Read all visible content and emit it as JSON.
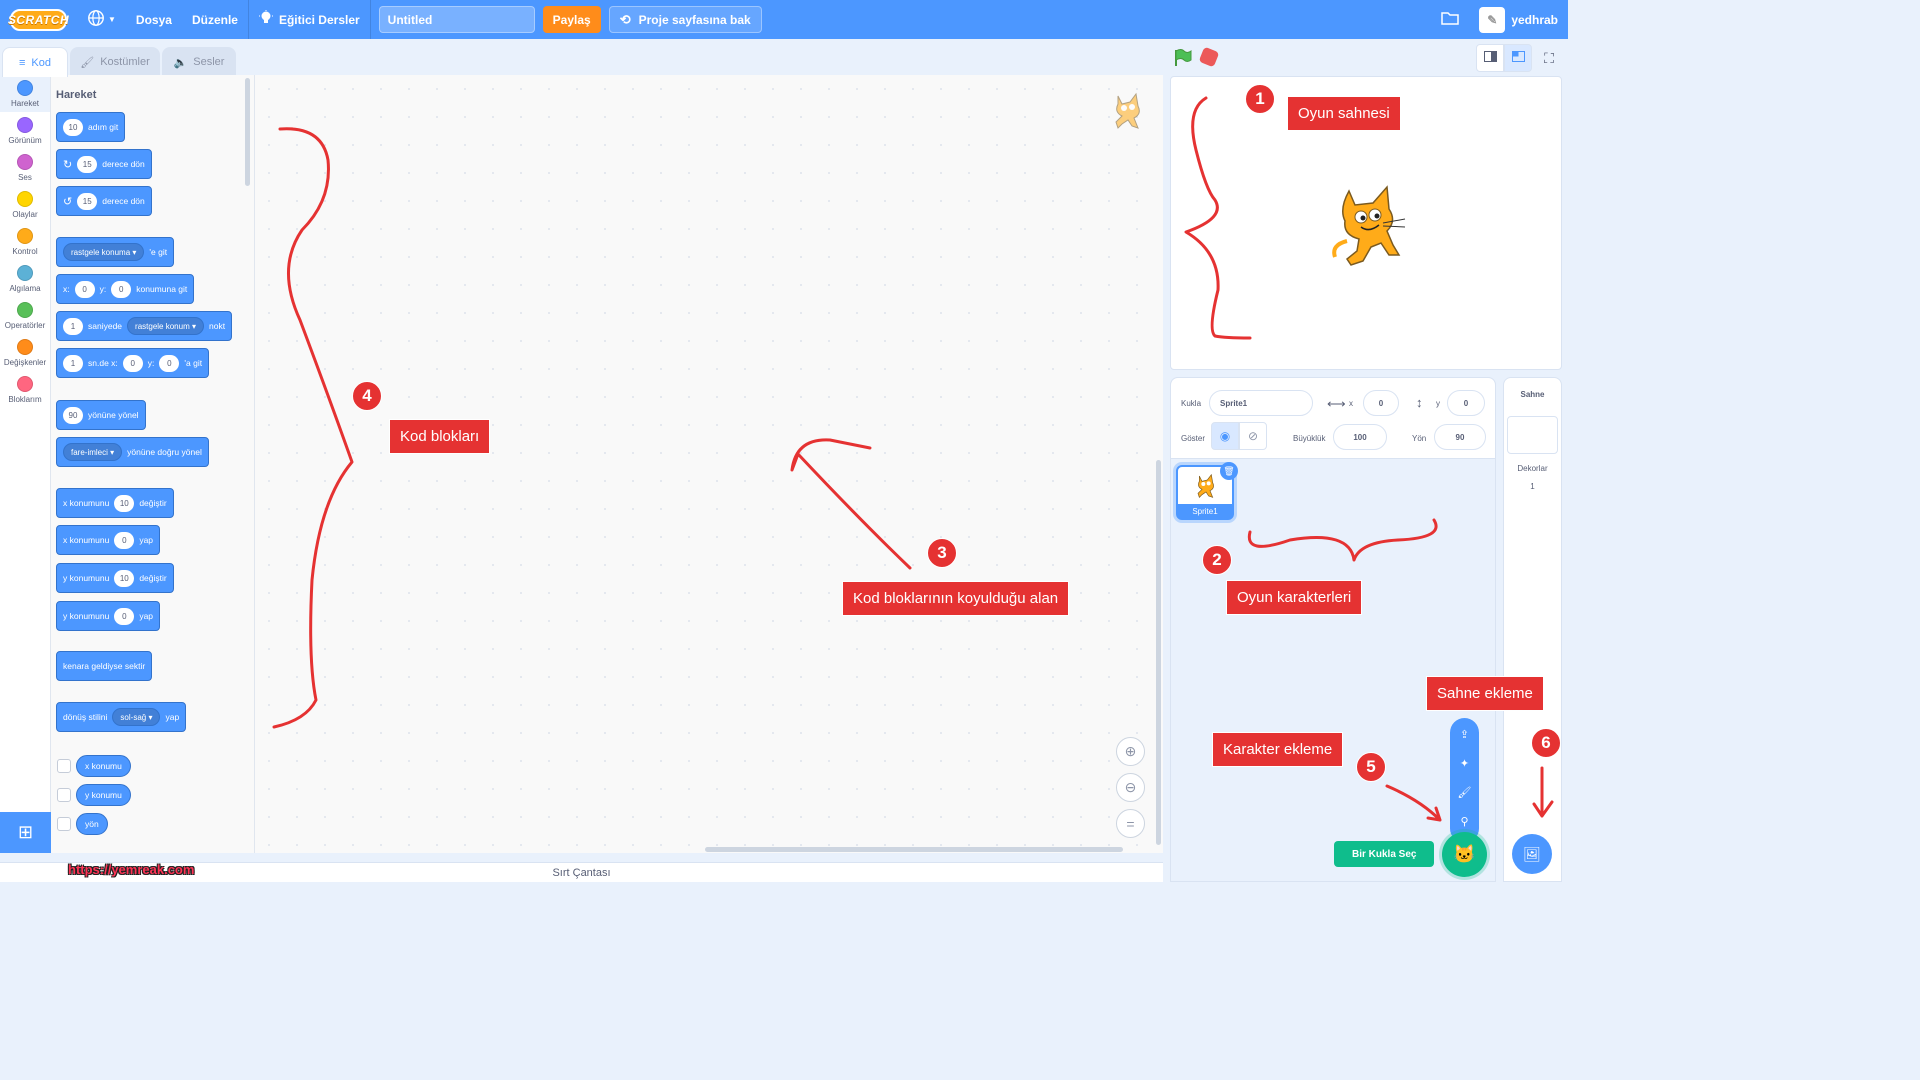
{
  "menubar": {
    "logo": "SCRATCH",
    "file": "Dosya",
    "edit": "Düzenle",
    "tutorials": "Eğitici Dersler",
    "project_title": "Untitled",
    "share": "Paylaş",
    "project_page": "Proje sayfasına bak",
    "username": "yedhrab"
  },
  "tabs": [
    {
      "label": "Kod",
      "icon": "code-icon"
    },
    {
      "label": "Kostümler",
      "icon": "brush-icon"
    },
    {
      "label": "Sesler",
      "icon": "speaker-icon"
    }
  ],
  "categories": [
    {
      "label": "Hareket",
      "color": "#4c97ff"
    },
    {
      "label": "Görünüm",
      "color": "#9966ff"
    },
    {
      "label": "Ses",
      "color": "#cf63cf"
    },
    {
      "label": "Olaylar",
      "color": "#ffd500"
    },
    {
      "label": "Kontrol",
      "color": "#ffab19"
    },
    {
      "label": "Algılama",
      "color": "#5cb1d6"
    },
    {
      "label": "Operatörler",
      "color": "#59c059"
    },
    {
      "label": "Değişkenler",
      "color": "#ff8c1a"
    },
    {
      "label": "Bloklarım",
      "color": "#ff6680"
    }
  ],
  "palette": {
    "title": "Hareket",
    "move": {
      "value": "10",
      "text": "adım git"
    },
    "turn_right": {
      "value": "15",
      "text": "derece dön"
    },
    "turn_left": {
      "value": "15",
      "text": "derece dön"
    },
    "goto": {
      "dropdown": "rastgele konuma",
      "text": "'e git"
    },
    "gotoxy": {
      "x_label": "x:",
      "x": "0",
      "y_label": "y:",
      "y": "0",
      "text": "konumuna git"
    },
    "glide": {
      "value": "1",
      "text": "saniyede",
      "dropdown": "rastgele konum",
      "tail": "nokt"
    },
    "glidexy": {
      "value": "1",
      "text": "sn.de x:",
      "x": "0",
      "y_label": "y:",
      "y": "0",
      "tail": "'a git"
    },
    "point_dir": {
      "value": "90",
      "text": "yönüne yönel"
    },
    "point_towards": {
      "dropdown": "fare-imleci",
      "text": "yönüne doğru yönel"
    },
    "change_x": {
      "text": "x konumunu",
      "value": "10",
      "tail": "değiştir"
    },
    "set_x": {
      "text": "x konumunu",
      "value": "0",
      "tail": "yap"
    },
    "change_y": {
      "text": "y konumunu",
      "value": "10",
      "tail": "değiştir"
    },
    "set_y": {
      "text": "y konumunu",
      "value": "0",
      "tail": "yap"
    },
    "bounce": {
      "text": "kenara geldiyse sektir"
    },
    "rotation": {
      "text": "dönüş stilini",
      "dropdown": "sol-sağ",
      "tail": "yap"
    },
    "reporters": [
      "x konumu",
      "y konumu",
      "yön"
    ]
  },
  "backpack": "Sırt Çantası",
  "watermark": "https://yemreak.com",
  "sprite_info": {
    "sprite_label": "Kukla",
    "sprite_name": "Sprite1",
    "x_label": "x",
    "x": "0",
    "y_label": "y",
    "y": "0",
    "show_label": "Göster",
    "size_label": "Büyüklük",
    "size": "100",
    "direction_label": "Yön",
    "direction": "90"
  },
  "sprites": [
    {
      "name": "Sprite1"
    }
  ],
  "target": {
    "title": "Sahne",
    "backdrops_label": "Dekorlar",
    "backdrops_count": "1"
  },
  "add_sprite_tooltip": "Bir Kukla Seç",
  "annotations": [
    {
      "num": "1",
      "label": "Oyun sahnesi"
    },
    {
      "num": "2",
      "label": "Oyun karakterleri"
    },
    {
      "num": "3",
      "label": "Kod bloklarının koyulduğu alan"
    },
    {
      "num": "4",
      "label": "Kod blokları"
    },
    {
      "num": "5",
      "label": "Karakter ekleme"
    },
    {
      "num": "6",
      "label": "Sahne ekleme"
    }
  ]
}
